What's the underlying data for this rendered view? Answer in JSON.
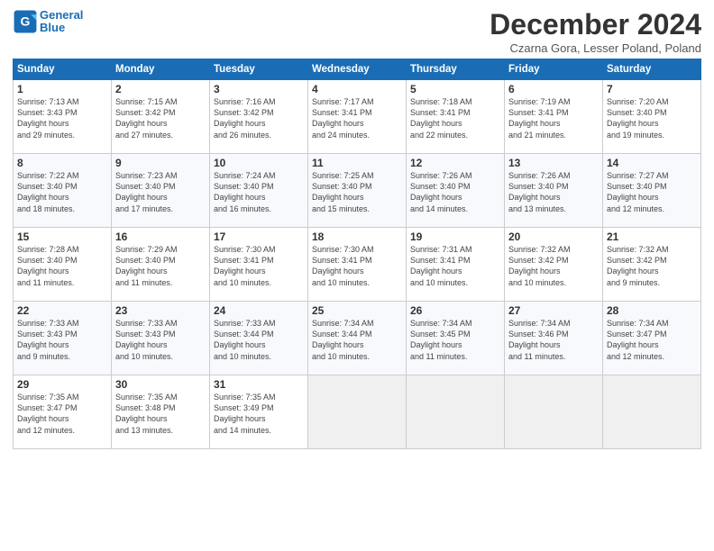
{
  "logo": {
    "line1": "General",
    "line2": "Blue"
  },
  "title": "December 2024",
  "location": "Czarna Gora, Lesser Poland, Poland",
  "days_of_week": [
    "Sunday",
    "Monday",
    "Tuesday",
    "Wednesday",
    "Thursday",
    "Friday",
    "Saturday"
  ],
  "weeks": [
    [
      {
        "day": 1,
        "sunrise": "7:13 AM",
        "sunset": "3:43 PM",
        "daylight": "8 hours and 29 minutes."
      },
      {
        "day": 2,
        "sunrise": "7:15 AM",
        "sunset": "3:42 PM",
        "daylight": "8 hours and 27 minutes."
      },
      {
        "day": 3,
        "sunrise": "7:16 AM",
        "sunset": "3:42 PM",
        "daylight": "8 hours and 26 minutes."
      },
      {
        "day": 4,
        "sunrise": "7:17 AM",
        "sunset": "3:41 PM",
        "daylight": "8 hours and 24 minutes."
      },
      {
        "day": 5,
        "sunrise": "7:18 AM",
        "sunset": "3:41 PM",
        "daylight": "8 hours and 22 minutes."
      },
      {
        "day": 6,
        "sunrise": "7:19 AM",
        "sunset": "3:41 PM",
        "daylight": "8 hours and 21 minutes."
      },
      {
        "day": 7,
        "sunrise": "7:20 AM",
        "sunset": "3:40 PM",
        "daylight": "8 hours and 19 minutes."
      }
    ],
    [
      {
        "day": 8,
        "sunrise": "7:22 AM",
        "sunset": "3:40 PM",
        "daylight": "8 hours and 18 minutes."
      },
      {
        "day": 9,
        "sunrise": "7:23 AM",
        "sunset": "3:40 PM",
        "daylight": "8 hours and 17 minutes."
      },
      {
        "day": 10,
        "sunrise": "7:24 AM",
        "sunset": "3:40 PM",
        "daylight": "8 hours and 16 minutes."
      },
      {
        "day": 11,
        "sunrise": "7:25 AM",
        "sunset": "3:40 PM",
        "daylight": "8 hours and 15 minutes."
      },
      {
        "day": 12,
        "sunrise": "7:26 AM",
        "sunset": "3:40 PM",
        "daylight": "8 hours and 14 minutes."
      },
      {
        "day": 13,
        "sunrise": "7:26 AM",
        "sunset": "3:40 PM",
        "daylight": "8 hours and 13 minutes."
      },
      {
        "day": 14,
        "sunrise": "7:27 AM",
        "sunset": "3:40 PM",
        "daylight": "8 hours and 12 minutes."
      }
    ],
    [
      {
        "day": 15,
        "sunrise": "7:28 AM",
        "sunset": "3:40 PM",
        "daylight": "8 hours and 11 minutes."
      },
      {
        "day": 16,
        "sunrise": "7:29 AM",
        "sunset": "3:40 PM",
        "daylight": "8 hours and 11 minutes."
      },
      {
        "day": 17,
        "sunrise": "7:30 AM",
        "sunset": "3:41 PM",
        "daylight": "8 hours and 10 minutes."
      },
      {
        "day": 18,
        "sunrise": "7:30 AM",
        "sunset": "3:41 PM",
        "daylight": "8 hours and 10 minutes."
      },
      {
        "day": 19,
        "sunrise": "7:31 AM",
        "sunset": "3:41 PM",
        "daylight": "8 hours and 10 minutes."
      },
      {
        "day": 20,
        "sunrise": "7:32 AM",
        "sunset": "3:42 PM",
        "daylight": "8 hours and 10 minutes."
      },
      {
        "day": 21,
        "sunrise": "7:32 AM",
        "sunset": "3:42 PM",
        "daylight": "8 hours and 9 minutes."
      }
    ],
    [
      {
        "day": 22,
        "sunrise": "7:33 AM",
        "sunset": "3:43 PM",
        "daylight": "8 hours and 9 minutes."
      },
      {
        "day": 23,
        "sunrise": "7:33 AM",
        "sunset": "3:43 PM",
        "daylight": "8 hours and 10 minutes."
      },
      {
        "day": 24,
        "sunrise": "7:33 AM",
        "sunset": "3:44 PM",
        "daylight": "8 hours and 10 minutes."
      },
      {
        "day": 25,
        "sunrise": "7:34 AM",
        "sunset": "3:44 PM",
        "daylight": "8 hours and 10 minutes."
      },
      {
        "day": 26,
        "sunrise": "7:34 AM",
        "sunset": "3:45 PM",
        "daylight": "8 hours and 11 minutes."
      },
      {
        "day": 27,
        "sunrise": "7:34 AM",
        "sunset": "3:46 PM",
        "daylight": "8 hours and 11 minutes."
      },
      {
        "day": 28,
        "sunrise": "7:34 AM",
        "sunset": "3:47 PM",
        "daylight": "8 hours and 12 minutes."
      }
    ],
    [
      {
        "day": 29,
        "sunrise": "7:35 AM",
        "sunset": "3:47 PM",
        "daylight": "8 hours and 12 minutes."
      },
      {
        "day": 30,
        "sunrise": "7:35 AM",
        "sunset": "3:48 PM",
        "daylight": "8 hours and 13 minutes."
      },
      {
        "day": 31,
        "sunrise": "7:35 AM",
        "sunset": "3:49 PM",
        "daylight": "8 hours and 14 minutes."
      },
      null,
      null,
      null,
      null
    ]
  ]
}
